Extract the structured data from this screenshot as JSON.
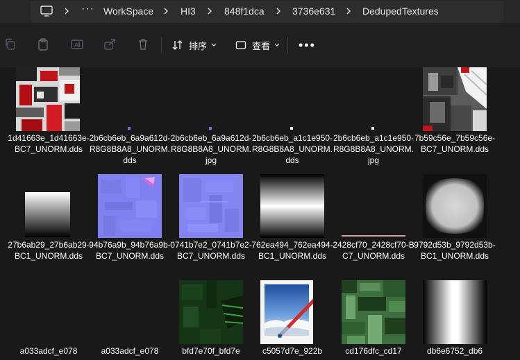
{
  "address_bar": {
    "breadcrumbs": [
      "WorkSpace",
      "HI3",
      "848f1dca",
      "3736e631",
      "DedupedTextures"
    ]
  },
  "command_bar": {
    "sort_label": "排序",
    "view_label": "查看",
    "more_label": "•••"
  },
  "files": [
    {
      "label": "1d41663e_1d41663e-BC7_UNORM.dds",
      "thumb": "red-texture"
    },
    {
      "label": "2b6cb6eb_6a9a612d-R8G8B8A8_UNORM.dds",
      "thumb": "purple-dot"
    },
    {
      "label": "2b6cb6eb_6a9a612d-R8G8B8A8_UNORM.jpg",
      "thumb": "purple-dot"
    },
    {
      "label": "2b6cb6eb_a1c1e950-R8G8B8A8_UNORM.dds",
      "thumb": "white-dot"
    },
    {
      "label": "2b6cb6eb_a1c1e950-R8G8B8A8_UNORM.jpg",
      "thumb": "white-dot"
    },
    {
      "label": "7b59c56e_7b59c56e-BC7_UNORM.dds",
      "thumb": "mech-texture"
    },
    {
      "label": "27b6ab29_27b6ab29-BC1_UNORM.dds",
      "thumb": "gradient-vertical"
    },
    {
      "label": "94b76a9b_94b76a9b-BC7_UNORM.dds",
      "thumb": "normal-map"
    },
    {
      "label": "0741b7e2_0741b7e2-BC7_UNORM.dds",
      "thumb": "normal-map"
    },
    {
      "label": "762ea494_762ea494-BC1_UNORM.dds",
      "thumb": "gradient-band"
    },
    {
      "label": "2428cf70_2428cf70-BC7_UNORM.dds",
      "thumb": "thin-line"
    },
    {
      "label": "9792d53b_9792d53b-BC1_UNORM.dds",
      "thumb": "vignette"
    },
    {
      "label": "a033adcf_e078",
      "thumb": "empty"
    },
    {
      "label": "a033adcf_e078",
      "thumb": "empty"
    },
    {
      "label": "bfd7e70f_bfd7e",
      "thumb": "dark-green"
    },
    {
      "label": "c5057d7e_922b",
      "thumb": "paint-icon"
    },
    {
      "label": "cd176dfc_cd17",
      "thumb": "green-texture"
    },
    {
      "label": "db6e6752_db6",
      "thumb": "gradient-horizontal"
    }
  ]
}
